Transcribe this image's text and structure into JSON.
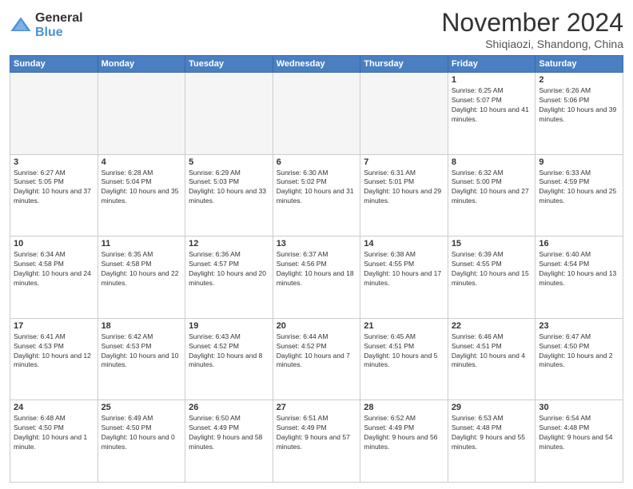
{
  "header": {
    "logo_general": "General",
    "logo_blue": "Blue",
    "month_title": "November 2024",
    "location": "Shiqiaozi, Shandong, China"
  },
  "days_of_week": [
    "Sunday",
    "Monday",
    "Tuesday",
    "Wednesday",
    "Thursday",
    "Friday",
    "Saturday"
  ],
  "weeks": [
    [
      {
        "day": "",
        "info": ""
      },
      {
        "day": "",
        "info": ""
      },
      {
        "day": "",
        "info": ""
      },
      {
        "day": "",
        "info": ""
      },
      {
        "day": "",
        "info": ""
      },
      {
        "day": "1",
        "info": "Sunrise: 6:25 AM\nSunset: 5:07 PM\nDaylight: 10 hours and 41 minutes."
      },
      {
        "day": "2",
        "info": "Sunrise: 6:26 AM\nSunset: 5:06 PM\nDaylight: 10 hours and 39 minutes."
      }
    ],
    [
      {
        "day": "3",
        "info": "Sunrise: 6:27 AM\nSunset: 5:05 PM\nDaylight: 10 hours and 37 minutes."
      },
      {
        "day": "4",
        "info": "Sunrise: 6:28 AM\nSunset: 5:04 PM\nDaylight: 10 hours and 35 minutes."
      },
      {
        "day": "5",
        "info": "Sunrise: 6:29 AM\nSunset: 5:03 PM\nDaylight: 10 hours and 33 minutes."
      },
      {
        "day": "6",
        "info": "Sunrise: 6:30 AM\nSunset: 5:02 PM\nDaylight: 10 hours and 31 minutes."
      },
      {
        "day": "7",
        "info": "Sunrise: 6:31 AM\nSunset: 5:01 PM\nDaylight: 10 hours and 29 minutes."
      },
      {
        "day": "8",
        "info": "Sunrise: 6:32 AM\nSunset: 5:00 PM\nDaylight: 10 hours and 27 minutes."
      },
      {
        "day": "9",
        "info": "Sunrise: 6:33 AM\nSunset: 4:59 PM\nDaylight: 10 hours and 25 minutes."
      }
    ],
    [
      {
        "day": "10",
        "info": "Sunrise: 6:34 AM\nSunset: 4:58 PM\nDaylight: 10 hours and 24 minutes."
      },
      {
        "day": "11",
        "info": "Sunrise: 6:35 AM\nSunset: 4:58 PM\nDaylight: 10 hours and 22 minutes."
      },
      {
        "day": "12",
        "info": "Sunrise: 6:36 AM\nSunset: 4:57 PM\nDaylight: 10 hours and 20 minutes."
      },
      {
        "day": "13",
        "info": "Sunrise: 6:37 AM\nSunset: 4:56 PM\nDaylight: 10 hours and 18 minutes."
      },
      {
        "day": "14",
        "info": "Sunrise: 6:38 AM\nSunset: 4:55 PM\nDaylight: 10 hours and 17 minutes."
      },
      {
        "day": "15",
        "info": "Sunrise: 6:39 AM\nSunset: 4:55 PM\nDaylight: 10 hours and 15 minutes."
      },
      {
        "day": "16",
        "info": "Sunrise: 6:40 AM\nSunset: 4:54 PM\nDaylight: 10 hours and 13 minutes."
      }
    ],
    [
      {
        "day": "17",
        "info": "Sunrise: 6:41 AM\nSunset: 4:53 PM\nDaylight: 10 hours and 12 minutes."
      },
      {
        "day": "18",
        "info": "Sunrise: 6:42 AM\nSunset: 4:53 PM\nDaylight: 10 hours and 10 minutes."
      },
      {
        "day": "19",
        "info": "Sunrise: 6:43 AM\nSunset: 4:52 PM\nDaylight: 10 hours and 8 minutes."
      },
      {
        "day": "20",
        "info": "Sunrise: 6:44 AM\nSunset: 4:52 PM\nDaylight: 10 hours and 7 minutes."
      },
      {
        "day": "21",
        "info": "Sunrise: 6:45 AM\nSunset: 4:51 PM\nDaylight: 10 hours and 5 minutes."
      },
      {
        "day": "22",
        "info": "Sunrise: 6:46 AM\nSunset: 4:51 PM\nDaylight: 10 hours and 4 minutes."
      },
      {
        "day": "23",
        "info": "Sunrise: 6:47 AM\nSunset: 4:50 PM\nDaylight: 10 hours and 2 minutes."
      }
    ],
    [
      {
        "day": "24",
        "info": "Sunrise: 6:48 AM\nSunset: 4:50 PM\nDaylight: 10 hours and 1 minute."
      },
      {
        "day": "25",
        "info": "Sunrise: 6:49 AM\nSunset: 4:50 PM\nDaylight: 10 hours and 0 minutes."
      },
      {
        "day": "26",
        "info": "Sunrise: 6:50 AM\nSunset: 4:49 PM\nDaylight: 9 hours and 58 minutes."
      },
      {
        "day": "27",
        "info": "Sunrise: 6:51 AM\nSunset: 4:49 PM\nDaylight: 9 hours and 57 minutes."
      },
      {
        "day": "28",
        "info": "Sunrise: 6:52 AM\nSunset: 4:49 PM\nDaylight: 9 hours and 56 minutes."
      },
      {
        "day": "29",
        "info": "Sunrise: 6:53 AM\nSunset: 4:48 PM\nDaylight: 9 hours and 55 minutes."
      },
      {
        "day": "30",
        "info": "Sunrise: 6:54 AM\nSunset: 4:48 PM\nDaylight: 9 hours and 54 minutes."
      }
    ]
  ]
}
